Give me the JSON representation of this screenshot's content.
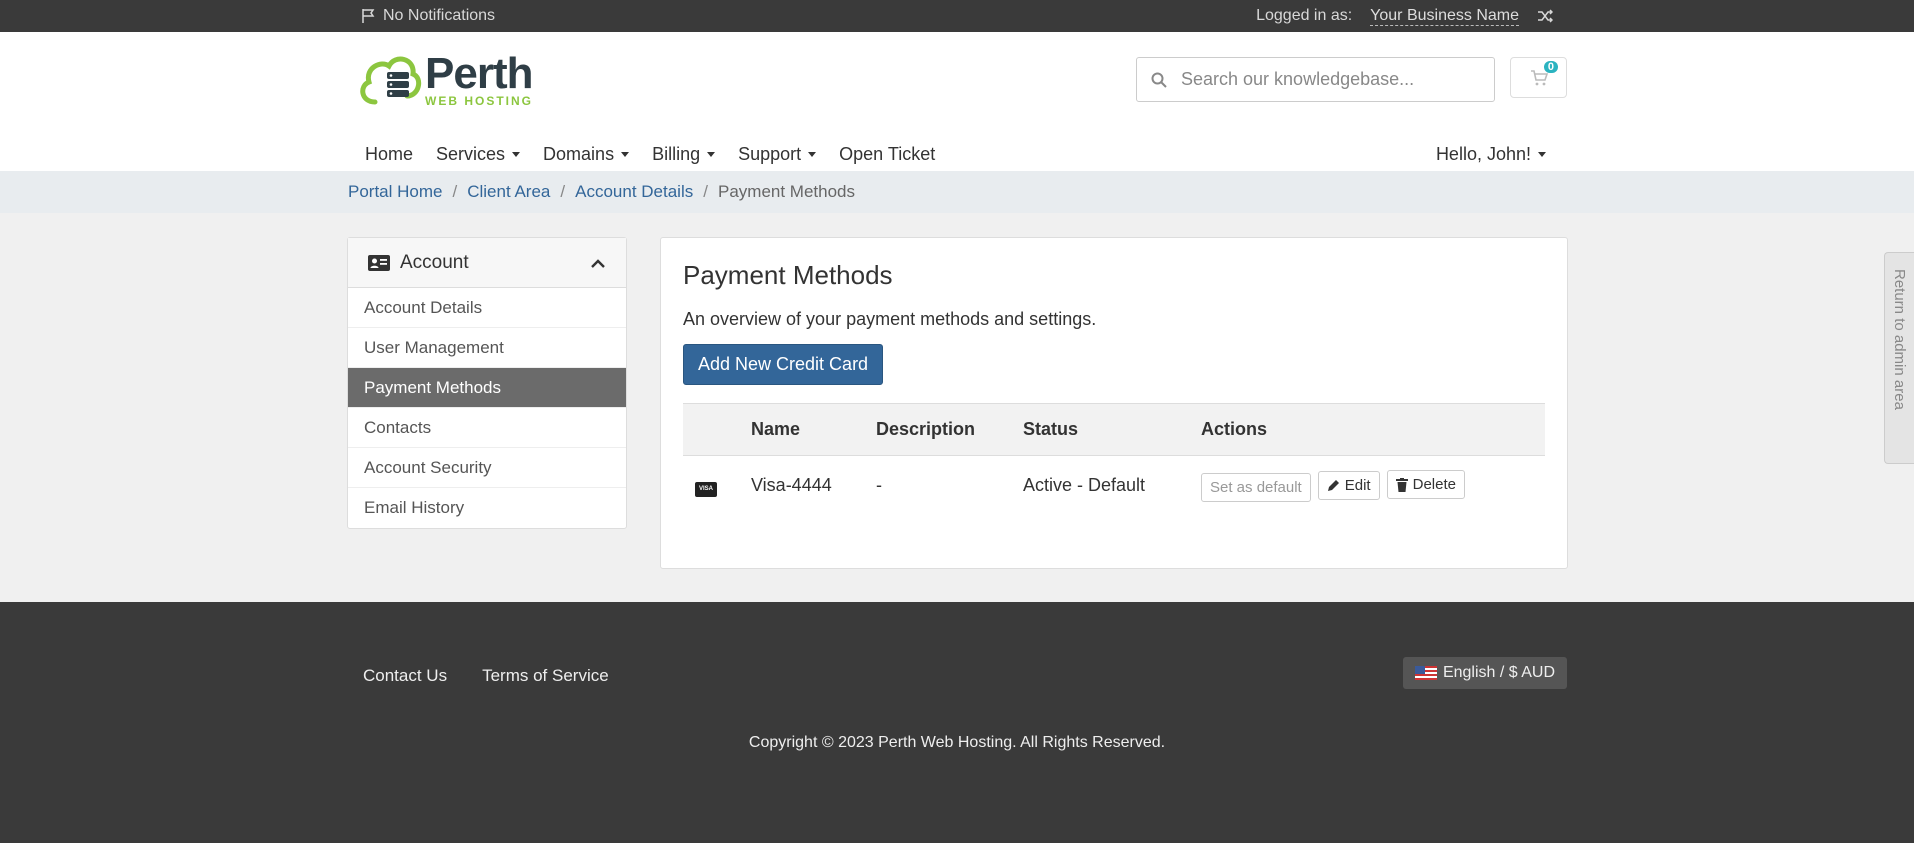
{
  "topbar": {
    "notifications": "No Notifications",
    "logged_in_label": "Logged in as:",
    "business_name": "Your Business Name"
  },
  "logo": {
    "name": "Perth",
    "tagline": "WEB HOSTING"
  },
  "search": {
    "placeholder": "Search our knowledgebase..."
  },
  "cart": {
    "count": "0"
  },
  "nav": {
    "items": [
      "Home",
      "Services",
      "Domains",
      "Billing",
      "Support",
      "Open Ticket"
    ],
    "user": "Hello, John!"
  },
  "breadcrumb": [
    "Portal Home",
    "Client Area",
    "Account Details",
    "Payment Methods"
  ],
  "sidebar": {
    "title": "Account",
    "items": [
      "Account Details",
      "User Management",
      "Payment Methods",
      "Contacts",
      "Account Security",
      "Email History"
    ],
    "active": "Payment Methods"
  },
  "main": {
    "title": "Payment Methods",
    "subtitle": "An overview of your payment methods and settings.",
    "add_button": "Add New Credit Card",
    "table": {
      "headers": [
        "",
        "Name",
        "Description",
        "Status",
        "Actions"
      ],
      "rows": [
        {
          "card": "VISA",
          "name": "Visa-4444",
          "description": "-",
          "status": "Active - Default"
        }
      ],
      "actions": {
        "set_default": "Set as default",
        "edit": "Edit",
        "delete": "Delete"
      }
    }
  },
  "admin_tab": "Return to admin area",
  "footer": {
    "links": [
      "Contact Us",
      "Terms of Service"
    ],
    "language": "English / $ AUD",
    "copyright": "Copyright © 2023 Perth Web Hosting. All Rights Reserved."
  },
  "colors": {
    "primary": "#336699",
    "dark": "#3a3a3a",
    "brand_green": "#8cc63f",
    "active_sidebar": "#6b6b6b"
  }
}
